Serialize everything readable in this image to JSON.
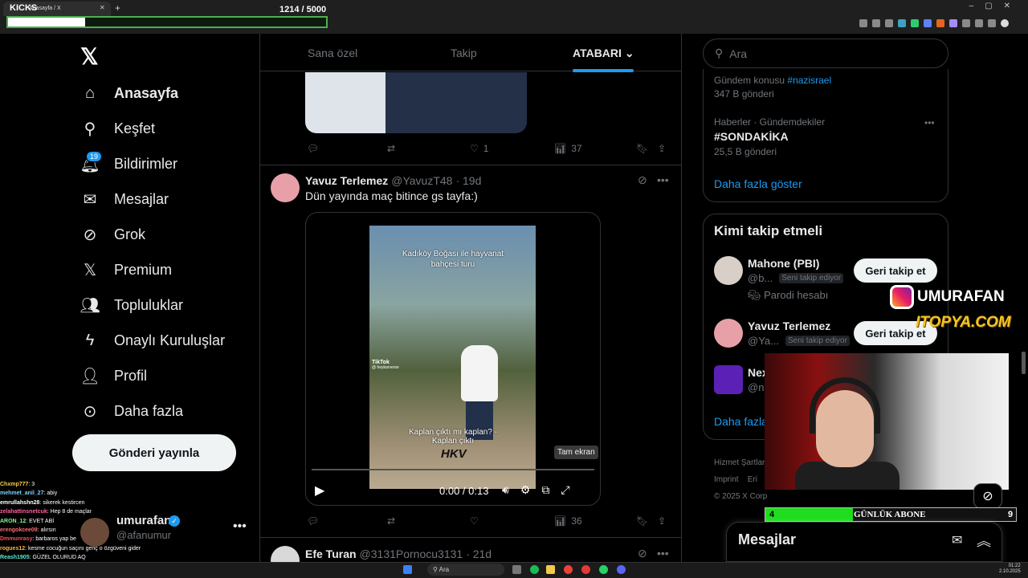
{
  "browser": {
    "tab_title": "Anasayfa / X",
    "overlay_label": "KICKS",
    "goal_text": "1214  / 5000",
    "goal_progress": 0.2428
  },
  "nav": {
    "items": [
      {
        "label": "Anasayfa",
        "icon": "home-icon"
      },
      {
        "label": "Keşfet",
        "icon": "search-icon"
      },
      {
        "label": "Bildirimler",
        "icon": "bell-icon"
      },
      {
        "label": "Mesajlar",
        "icon": "mail-icon"
      },
      {
        "label": "Grok",
        "icon": "grok-icon"
      },
      {
        "label": "Premium",
        "icon": "x-icon"
      },
      {
        "label": "Topluluklar",
        "icon": "people-icon"
      },
      {
        "label": "Onaylı Kuruluşlar",
        "icon": "lightning-icon"
      },
      {
        "label": "Profil",
        "icon": "person-icon"
      },
      {
        "label": "Daha fazla",
        "icon": "more-circle-icon"
      }
    ],
    "notification_count": "19",
    "post_button": "Gönderi yayınla",
    "profile_name": "umurafan",
    "profile_handle": "@afanumur"
  },
  "timeline_tabs": [
    "Sana özel",
    "Takip",
    "ATABARI"
  ],
  "tweet0": {
    "likes": "1",
    "views": "37"
  },
  "tweet1": {
    "name": "Yavuz Terlemez",
    "handle": "@YavuzT48",
    "time": "· 19d",
    "text": "Dün yayında maç bitince gs tayfa:)",
    "video_caption_top": "Kadıköy Boğası ile hayvanat bahçesi turu",
    "video_caption_bottom": "Kaplan çıktı mı kaplan? -Kaplan çıktı",
    "video_watermark": "TikTok",
    "video_watermark_handle": "@ heykarverse",
    "video_logo": "HKV",
    "video_time": "0:00 / 0:13",
    "tooltip": "Tam ekran",
    "views": "36"
  },
  "tweet2": {
    "name": "Efe Turan",
    "handle": "@3131Pornocu3131",
    "time": "· 21d"
  },
  "right": {
    "search_placeholder": "Ara",
    "trends": [
      {
        "meta": "Gündem konusu",
        "tag": "#nazisrael",
        "count": "347 B gönderi"
      },
      {
        "meta": "Haberler · Gündemdekiler",
        "tag": "#SONDAKİKA",
        "count": "25,5 B gönderi"
      }
    ],
    "show_more": "Daha fazla göster",
    "who_title": "Kimi takip etmeli",
    "who": [
      {
        "name": "Mahone (PBI)",
        "handle": "@b...",
        "badge": "Seni takip ediyor",
        "note": "Parodi hesabı",
        "button": "Geri takip et"
      },
      {
        "name": "Yavuz Terlemez",
        "handle": "@Ya...",
        "badge": "Seni takip ediyor",
        "button": "Geri takip et"
      },
      {
        "name": "Nex",
        "handle": "@n"
      }
    ],
    "who_more": "Daha fazla",
    "footer": [
      "Hizmet Şartlar",
      "Imprint",
      "Eri",
      "© 2025 X Corp"
    ]
  },
  "overlay": {
    "instagram": "UMURAFAN",
    "site": "ITOPYA.COM",
    "sub_label": "GÜNLÜK ABONE",
    "sub_left": "4",
    "sub_right": "9",
    "sub_progress": 0.35,
    "messages_title": "Mesajlar"
  },
  "chat": [
    {
      "user": "Chxmp777",
      "msg": ": 3",
      "color": "#f7d047"
    },
    {
      "user": "mehmet_anil_27",
      "msg": ": abiy",
      "color": "#7dd3fc"
    },
    {
      "user": "emrullahshn28",
      "msg": ": sikerek kestircen",
      "color": "#ffffff"
    },
    {
      "user": "zelahattinsnetcuk",
      "msg": ": Hep 8 de maçlar",
      "color": "#ff5fa2"
    },
    {
      "user": "ARON_12",
      "msg": ": EVET ABİ",
      "color": "#8cf58c"
    },
    {
      "user": "erengokcee09",
      "msg": ": alırsın",
      "color": "#ff6b6b"
    },
    {
      "user": "Dmmunrasy",
      "msg": ": barbaros yap be",
      "color": "#ff4d4d"
    },
    {
      "user": "rogues12",
      "msg": ": kesme cocuğun saçını genç o özgüveni gider",
      "color": "#ffb347"
    },
    {
      "user": "Reash1905",
      "msg": ": GÜZEL OLURUD AQ",
      "color": "#5eead4"
    }
  ],
  "taskbar": {
    "search": "Ara",
    "time": "01:22",
    "date": "2.10.2025"
  }
}
